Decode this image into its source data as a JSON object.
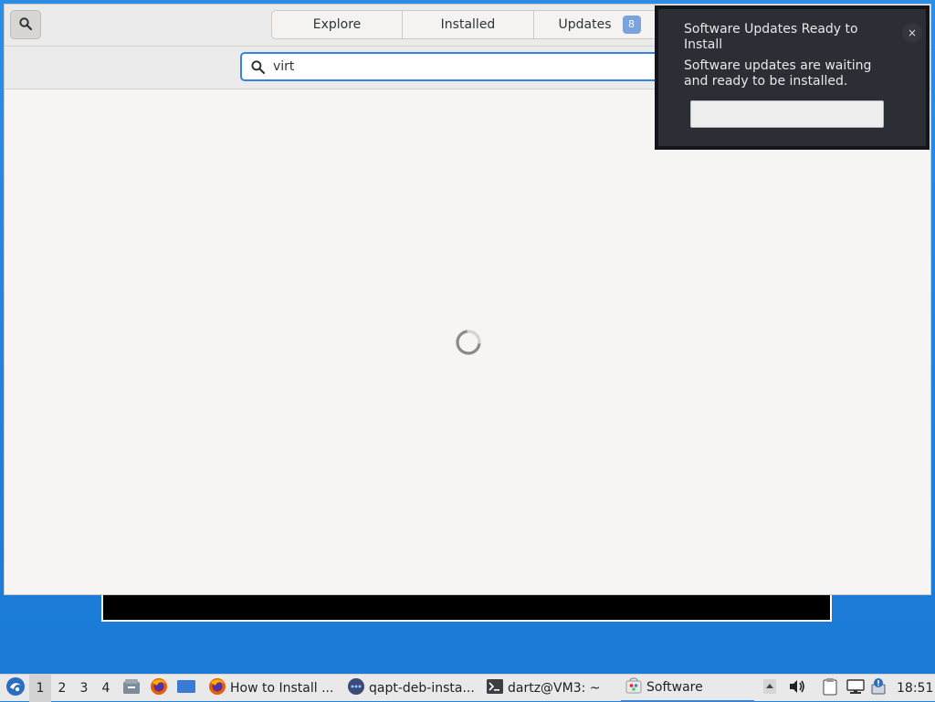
{
  "app": {
    "tabs": [
      {
        "label": "Explore"
      },
      {
        "label": "Installed"
      },
      {
        "label": "Updates",
        "badge": "8"
      }
    ],
    "search": {
      "value": "virt"
    }
  },
  "notification": {
    "title": "Software Updates Ready to Install",
    "body": "Software updates are waiting and ready to be installed.",
    "close": "×",
    "action_label": ""
  },
  "taskbar": {
    "workspaces": [
      "1",
      "2",
      "3",
      "4"
    ],
    "tasks": [
      {
        "label": "How to Install ..."
      },
      {
        "label": "qapt-deb-insta..."
      },
      {
        "label": "dartz@VM3: ~"
      },
      {
        "label": "Software"
      }
    ],
    "clock": "18:51"
  },
  "colors": {
    "accent": "#3584e4",
    "desktop": "#1f86e0",
    "notification_bg": "#2b2e34"
  }
}
